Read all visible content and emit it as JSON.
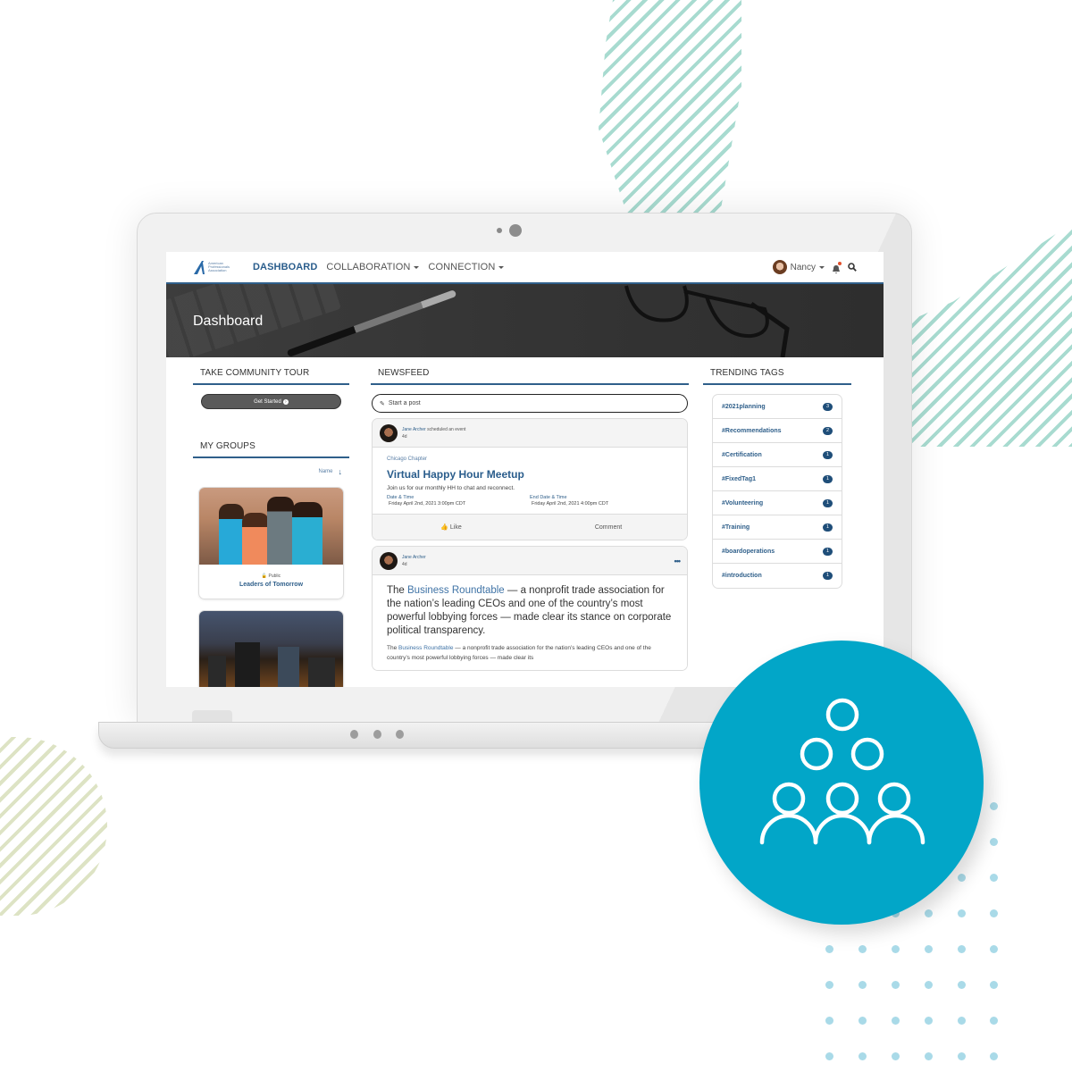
{
  "colors": {
    "brand_blue": "#2f5f8a",
    "accent_cyan": "#02a6c8",
    "tag_count_bg": "#1f4e79",
    "notification_dot": "#e2502b"
  },
  "topbar": {
    "logo_text": "American Professionals Association",
    "nav": [
      {
        "label": "DASHBOARD",
        "active": true,
        "has_dropdown": false
      },
      {
        "label": "COLLABORATION",
        "active": false,
        "has_dropdown": true
      },
      {
        "label": "CONNECTION",
        "active": false,
        "has_dropdown": true
      }
    ],
    "user_name": "Nancy",
    "icons": [
      "avatar",
      "chevron-down-icon",
      "bell-icon",
      "search-icon"
    ]
  },
  "hero": {
    "title": "Dashboard"
  },
  "left": {
    "tour_heading": "TAKE COMMUNITY TOUR",
    "get_started_label": "Get Started",
    "groups_heading": "MY GROUPS",
    "sort_label": "Name",
    "groups": [
      {
        "privacy": "Public",
        "name": "Leaders of Tomorrow"
      },
      {
        "privacy": "",
        "name": ""
      }
    ]
  },
  "newsfeed": {
    "heading": "NEWSFEED",
    "post_placeholder": "Start a post",
    "posts": [
      {
        "author": "Jane Archer",
        "action": "scheduled an event",
        "age": "4d",
        "chapter": "Chicago Chapter",
        "title": "Virtual Happy Hour Meetup",
        "description": "Join us for our monthly HH to chat and reconnect.",
        "start_label": "Date & Time",
        "start_value": "Friday April 2nd, 2021 3:00pm CDT",
        "end_label": "End Date & Time",
        "end_value": "Friday April 2nd, 2021 4:00pm CDT",
        "like_label": "Like",
        "comment_label": "Comment"
      },
      {
        "author": "Jane Archer",
        "age": "4d",
        "headline_pre": "The ",
        "headline_link": "Business Roundtable",
        "headline_post": " — a nonprofit trade association for the nation’s leading CEOs and one of the country’s most powerful lobbying forces — made clear its stance on corporate political transparency.",
        "body_pre": "The ",
        "body_link": "Business Roundtable",
        "body_post": " — a nonprofit trade association for the nation’s leading CEOs and one of the country’s most powerful lobbying forces — made clear its"
      }
    ]
  },
  "trending": {
    "heading": "TRENDING TAGS",
    "tags": [
      {
        "label": "#2021planning",
        "count": "3"
      },
      {
        "label": "#Recommendations",
        "count": "2"
      },
      {
        "label": "#Certification",
        "count": "1"
      },
      {
        "label": "#FixedTag1",
        "count": "1"
      },
      {
        "label": "#Volunteering",
        "count": "1"
      },
      {
        "label": "#Training",
        "count": "1"
      },
      {
        "label": "#boardoperations",
        "count": "1"
      },
      {
        "label": "#introduction",
        "count": "1"
      }
    ]
  },
  "badge": {
    "icon": "community-group-icon"
  }
}
